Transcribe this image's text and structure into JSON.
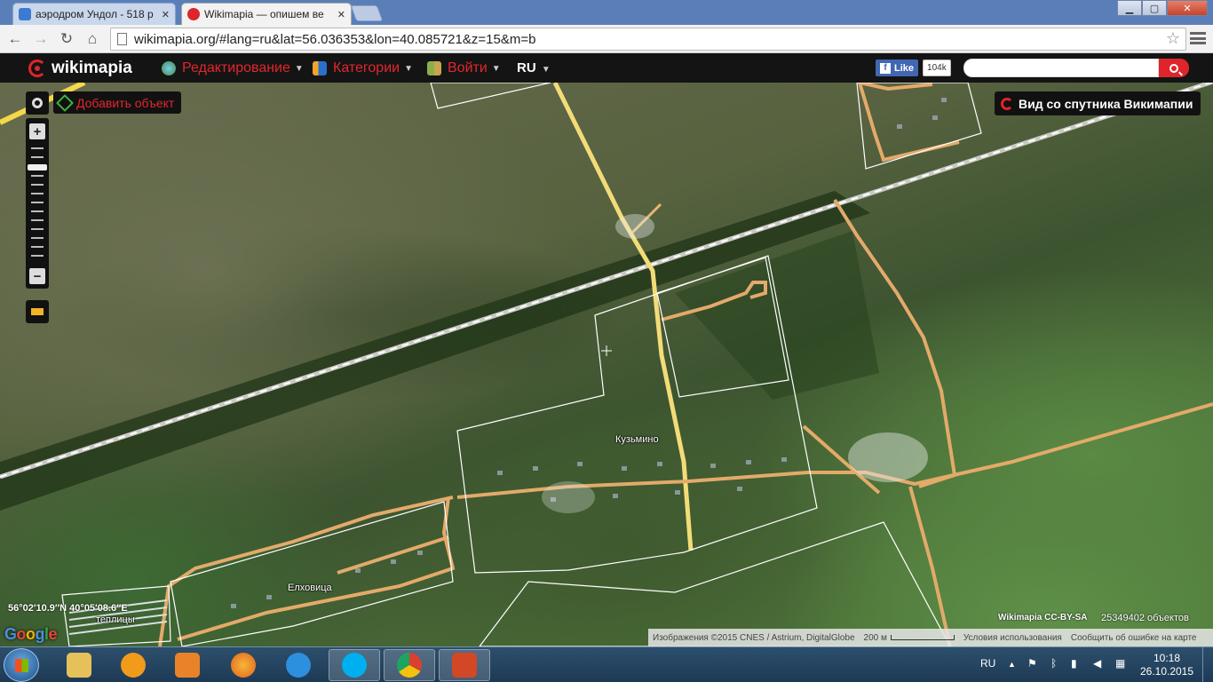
{
  "browser": {
    "tabs": [
      {
        "title": "аэродром Ундол - 518 р",
        "active": false,
        "favicon_color": "#3b7bd4",
        "icon": "search-favicon-icon"
      },
      {
        "title": "Wikimapia — опишем ве",
        "active": true,
        "favicon_color": "#e0242b",
        "icon": "wikimapia-favicon-icon"
      }
    ],
    "url": "wikimapia.org/#lang=ru&lat=56.036353&lon=40.085721&z=15&m=b",
    "window_buttons": {
      "minimize": "▁",
      "maximize": "▢",
      "close": "✕"
    },
    "nav_glyphs": {
      "back": "←",
      "forward": "→",
      "reload": "↻",
      "home": "⌂",
      "bookmark": "☆"
    }
  },
  "toolbar": {
    "logo": "wikimapia",
    "menu": [
      {
        "label": "Редактирование",
        "icon": "globe-edit-icon"
      },
      {
        "label": "Категории",
        "icon": "categories-tree-icon"
      },
      {
        "label": "Войти",
        "icon": "login-door-icon"
      }
    ],
    "language": "RU",
    "facebook_like_label": "Like",
    "facebook_like_count": "104k",
    "search_placeholder": ""
  },
  "map": {
    "add_object_label": "Добавить объект",
    "satellite_view_label": "Вид со спутника Викимапии",
    "zoom_in": "+",
    "zoom_out": "−",
    "labels": {
      "kuzmino": "Кузьмино",
      "elkhovitsa": "Елховица",
      "greenhouses": "теплицы"
    },
    "coordinates": "56°02′10.9″N 40°05′08.6″E",
    "google_logo": [
      "G",
      "o",
      "o",
      "g",
      "l",
      "e"
    ],
    "license": "Wikimapia CC-BY-SA",
    "object_count": "25349402 объектов",
    "attribution": {
      "imagery": "Изображения ©2015 CNES / Astrium, DigitalGlobe",
      "scale": "200 м",
      "terms": "Условия использования",
      "report": "Сообщить об ошибке на карте"
    }
  },
  "taskbar": {
    "apps": [
      {
        "name": "explorer",
        "icon": "folder-icon",
        "color": "#e6c15a",
        "active": false
      },
      {
        "name": "aimp",
        "icon": "aimp-triangle-icon",
        "color": "#f29a1a",
        "active": false
      },
      {
        "name": "video-player",
        "icon": "video-play-icon",
        "color": "#e8832a",
        "active": false
      },
      {
        "name": "firefox",
        "icon": "firefox-icon",
        "color": "#e2621b",
        "active": false
      },
      {
        "name": "internet-explorer",
        "icon": "internet-explorer-icon",
        "color": "#2d8fe0",
        "active": false
      },
      {
        "name": "skype",
        "icon": "skype-icon",
        "color": "#00aff0",
        "active": true
      },
      {
        "name": "chrome",
        "icon": "chrome-icon",
        "color": "#d9412f",
        "active": true
      },
      {
        "name": "presentation",
        "icon": "slides-icon",
        "color": "#d24726",
        "active": true
      }
    ],
    "language": "RU",
    "tray_glyphs": {
      "arrow": "▲",
      "flag": "⚑",
      "bluetooth": "ᛒ",
      "power": "▮",
      "volume": "◀",
      "network": "▦"
    },
    "time": "10:18",
    "date": "26.10.2015"
  }
}
